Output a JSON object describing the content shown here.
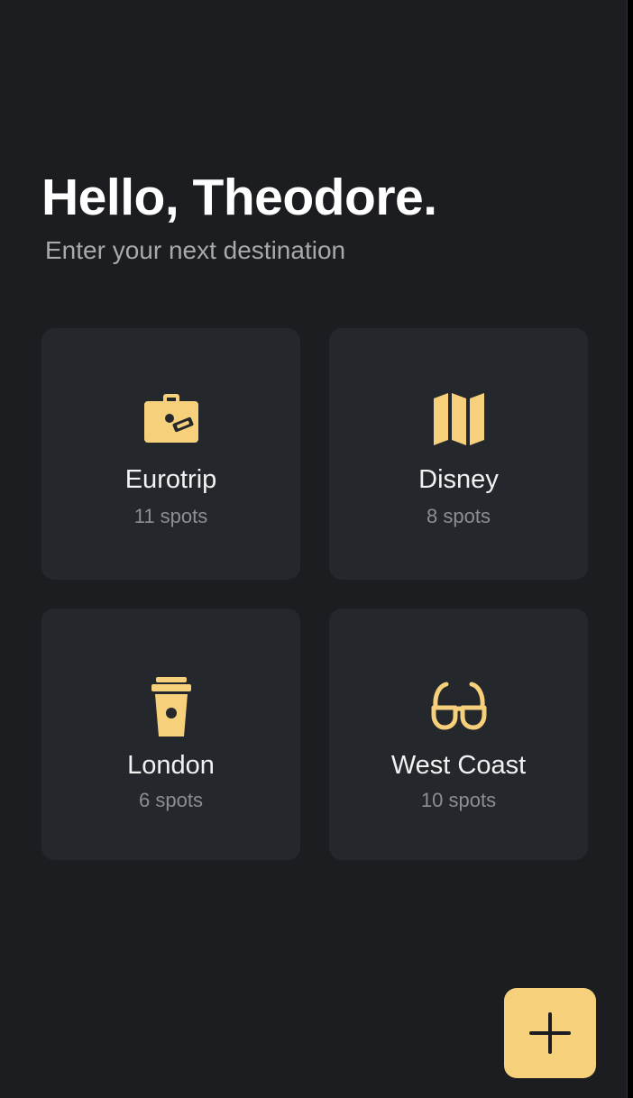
{
  "header": {
    "greeting": "Hello, Theodore.",
    "subtitle": "Enter your next destination"
  },
  "trips": [
    {
      "title": "Eurotrip",
      "count": "11 spots",
      "icon": "suitcase-icon"
    },
    {
      "title": "Disney",
      "count": "8 spots",
      "icon": "map-icon"
    },
    {
      "title": "London",
      "count": "6 spots",
      "icon": "coffee-cup-icon"
    },
    {
      "title": "West Coast",
      "count": "10 spots",
      "icon": "sunglasses-icon"
    }
  ],
  "fab": {
    "icon": "plus-icon"
  },
  "colors": {
    "background": "#1b1d20",
    "card": "#24272c",
    "accent": "#f6d07a"
  }
}
